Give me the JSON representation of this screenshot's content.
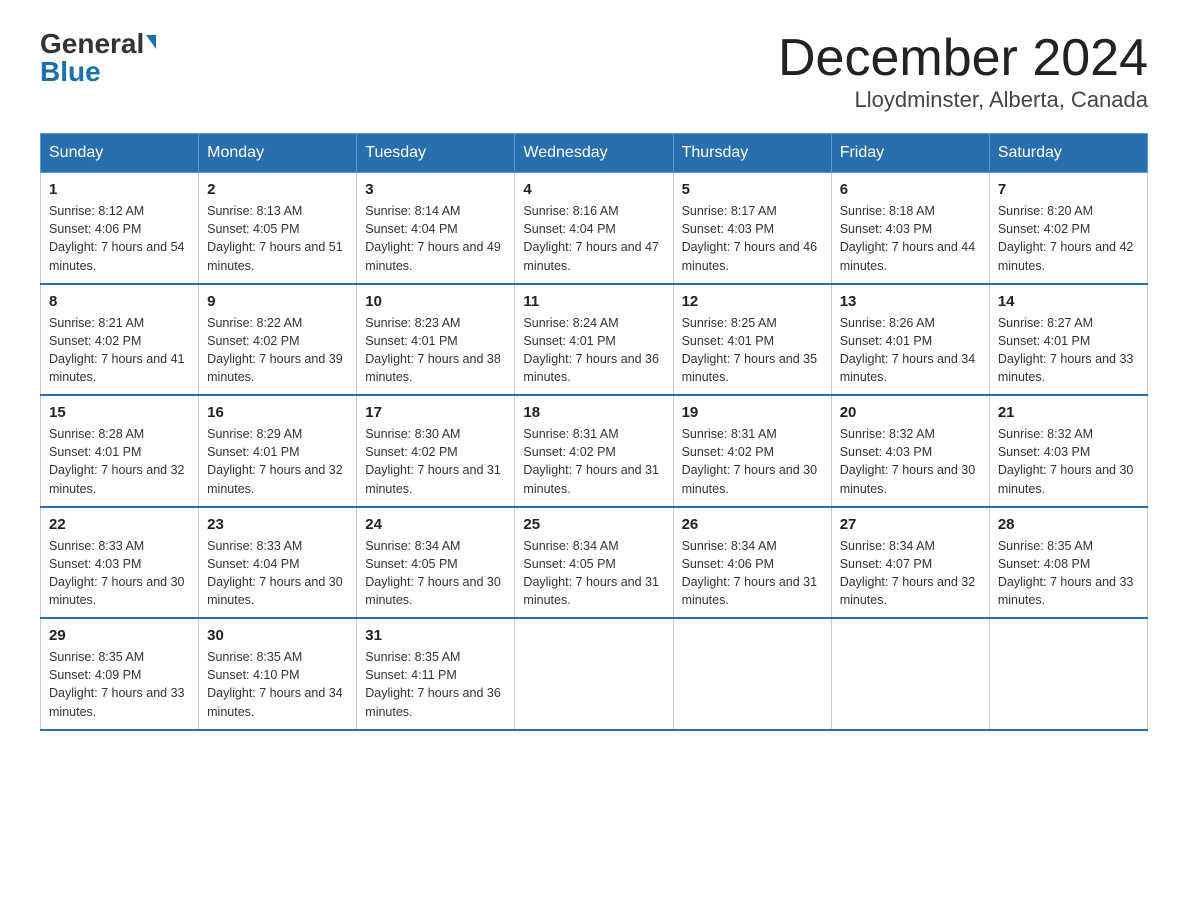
{
  "logo": {
    "general": "General",
    "blue": "Blue"
  },
  "title": {
    "month_year": "December 2024",
    "location": "Lloydminster, Alberta, Canada"
  },
  "days_of_week": [
    "Sunday",
    "Monday",
    "Tuesday",
    "Wednesday",
    "Thursday",
    "Friday",
    "Saturday"
  ],
  "weeks": [
    [
      {
        "day": "1",
        "sunrise": "8:12 AM",
        "sunset": "4:06 PM",
        "daylight": "7 hours and 54 minutes."
      },
      {
        "day": "2",
        "sunrise": "8:13 AM",
        "sunset": "4:05 PM",
        "daylight": "7 hours and 51 minutes."
      },
      {
        "day": "3",
        "sunrise": "8:14 AM",
        "sunset": "4:04 PM",
        "daylight": "7 hours and 49 minutes."
      },
      {
        "day": "4",
        "sunrise": "8:16 AM",
        "sunset": "4:04 PM",
        "daylight": "7 hours and 47 minutes."
      },
      {
        "day": "5",
        "sunrise": "8:17 AM",
        "sunset": "4:03 PM",
        "daylight": "7 hours and 46 minutes."
      },
      {
        "day": "6",
        "sunrise": "8:18 AM",
        "sunset": "4:03 PM",
        "daylight": "7 hours and 44 minutes."
      },
      {
        "day": "7",
        "sunrise": "8:20 AM",
        "sunset": "4:02 PM",
        "daylight": "7 hours and 42 minutes."
      }
    ],
    [
      {
        "day": "8",
        "sunrise": "8:21 AM",
        "sunset": "4:02 PM",
        "daylight": "7 hours and 41 minutes."
      },
      {
        "day": "9",
        "sunrise": "8:22 AM",
        "sunset": "4:02 PM",
        "daylight": "7 hours and 39 minutes."
      },
      {
        "day": "10",
        "sunrise": "8:23 AM",
        "sunset": "4:01 PM",
        "daylight": "7 hours and 38 minutes."
      },
      {
        "day": "11",
        "sunrise": "8:24 AM",
        "sunset": "4:01 PM",
        "daylight": "7 hours and 36 minutes."
      },
      {
        "day": "12",
        "sunrise": "8:25 AM",
        "sunset": "4:01 PM",
        "daylight": "7 hours and 35 minutes."
      },
      {
        "day": "13",
        "sunrise": "8:26 AM",
        "sunset": "4:01 PM",
        "daylight": "7 hours and 34 minutes."
      },
      {
        "day": "14",
        "sunrise": "8:27 AM",
        "sunset": "4:01 PM",
        "daylight": "7 hours and 33 minutes."
      }
    ],
    [
      {
        "day": "15",
        "sunrise": "8:28 AM",
        "sunset": "4:01 PM",
        "daylight": "7 hours and 32 minutes."
      },
      {
        "day": "16",
        "sunrise": "8:29 AM",
        "sunset": "4:01 PM",
        "daylight": "7 hours and 32 minutes."
      },
      {
        "day": "17",
        "sunrise": "8:30 AM",
        "sunset": "4:02 PM",
        "daylight": "7 hours and 31 minutes."
      },
      {
        "day": "18",
        "sunrise": "8:31 AM",
        "sunset": "4:02 PM",
        "daylight": "7 hours and 31 minutes."
      },
      {
        "day": "19",
        "sunrise": "8:31 AM",
        "sunset": "4:02 PM",
        "daylight": "7 hours and 30 minutes."
      },
      {
        "day": "20",
        "sunrise": "8:32 AM",
        "sunset": "4:03 PM",
        "daylight": "7 hours and 30 minutes."
      },
      {
        "day": "21",
        "sunrise": "8:32 AM",
        "sunset": "4:03 PM",
        "daylight": "7 hours and 30 minutes."
      }
    ],
    [
      {
        "day": "22",
        "sunrise": "8:33 AM",
        "sunset": "4:03 PM",
        "daylight": "7 hours and 30 minutes."
      },
      {
        "day": "23",
        "sunrise": "8:33 AM",
        "sunset": "4:04 PM",
        "daylight": "7 hours and 30 minutes."
      },
      {
        "day": "24",
        "sunrise": "8:34 AM",
        "sunset": "4:05 PM",
        "daylight": "7 hours and 30 minutes."
      },
      {
        "day": "25",
        "sunrise": "8:34 AM",
        "sunset": "4:05 PM",
        "daylight": "7 hours and 31 minutes."
      },
      {
        "day": "26",
        "sunrise": "8:34 AM",
        "sunset": "4:06 PM",
        "daylight": "7 hours and 31 minutes."
      },
      {
        "day": "27",
        "sunrise": "8:34 AM",
        "sunset": "4:07 PM",
        "daylight": "7 hours and 32 minutes."
      },
      {
        "day": "28",
        "sunrise": "8:35 AM",
        "sunset": "4:08 PM",
        "daylight": "7 hours and 33 minutes."
      }
    ],
    [
      {
        "day": "29",
        "sunrise": "8:35 AM",
        "sunset": "4:09 PM",
        "daylight": "7 hours and 33 minutes."
      },
      {
        "day": "30",
        "sunrise": "8:35 AM",
        "sunset": "4:10 PM",
        "daylight": "7 hours and 34 minutes."
      },
      {
        "day": "31",
        "sunrise": "8:35 AM",
        "sunset": "4:11 PM",
        "daylight": "7 hours and 36 minutes."
      },
      null,
      null,
      null,
      null
    ]
  ]
}
